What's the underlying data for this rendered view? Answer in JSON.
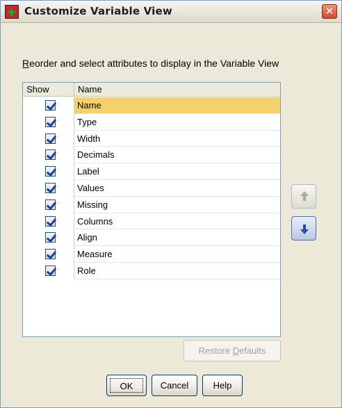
{
  "window": {
    "title": "Customize Variable View",
    "close_glyph": "✕"
  },
  "instruction": {
    "accel": "R",
    "text": "eorder and select attributes to display in the Variable View"
  },
  "list": {
    "columns": {
      "show": "Show",
      "name": "Name"
    },
    "rows": [
      {
        "name": "Name",
        "checked": true,
        "selected": true
      },
      {
        "name": "Type",
        "checked": true,
        "selected": false
      },
      {
        "name": "Width",
        "checked": true,
        "selected": false
      },
      {
        "name": "Decimals",
        "checked": true,
        "selected": false
      },
      {
        "name": "Label",
        "checked": true,
        "selected": false
      },
      {
        "name": "Values",
        "checked": true,
        "selected": false
      },
      {
        "name": "Missing",
        "checked": true,
        "selected": false
      },
      {
        "name": "Columns",
        "checked": true,
        "selected": false
      },
      {
        "name": "Align",
        "checked": true,
        "selected": false
      },
      {
        "name": "Measure",
        "checked": true,
        "selected": false
      },
      {
        "name": "Role",
        "checked": true,
        "selected": false
      }
    ],
    "selection_color": "#f5d16a"
  },
  "buttons": {
    "move_up_icon": "arrow-up-icon",
    "move_down_icon": "arrow-down-icon",
    "restore_prefix": "Restore ",
    "restore_accel": "D",
    "restore_suffix": "efaults",
    "ok": "OK",
    "cancel": "Cancel",
    "help": "Help"
  }
}
